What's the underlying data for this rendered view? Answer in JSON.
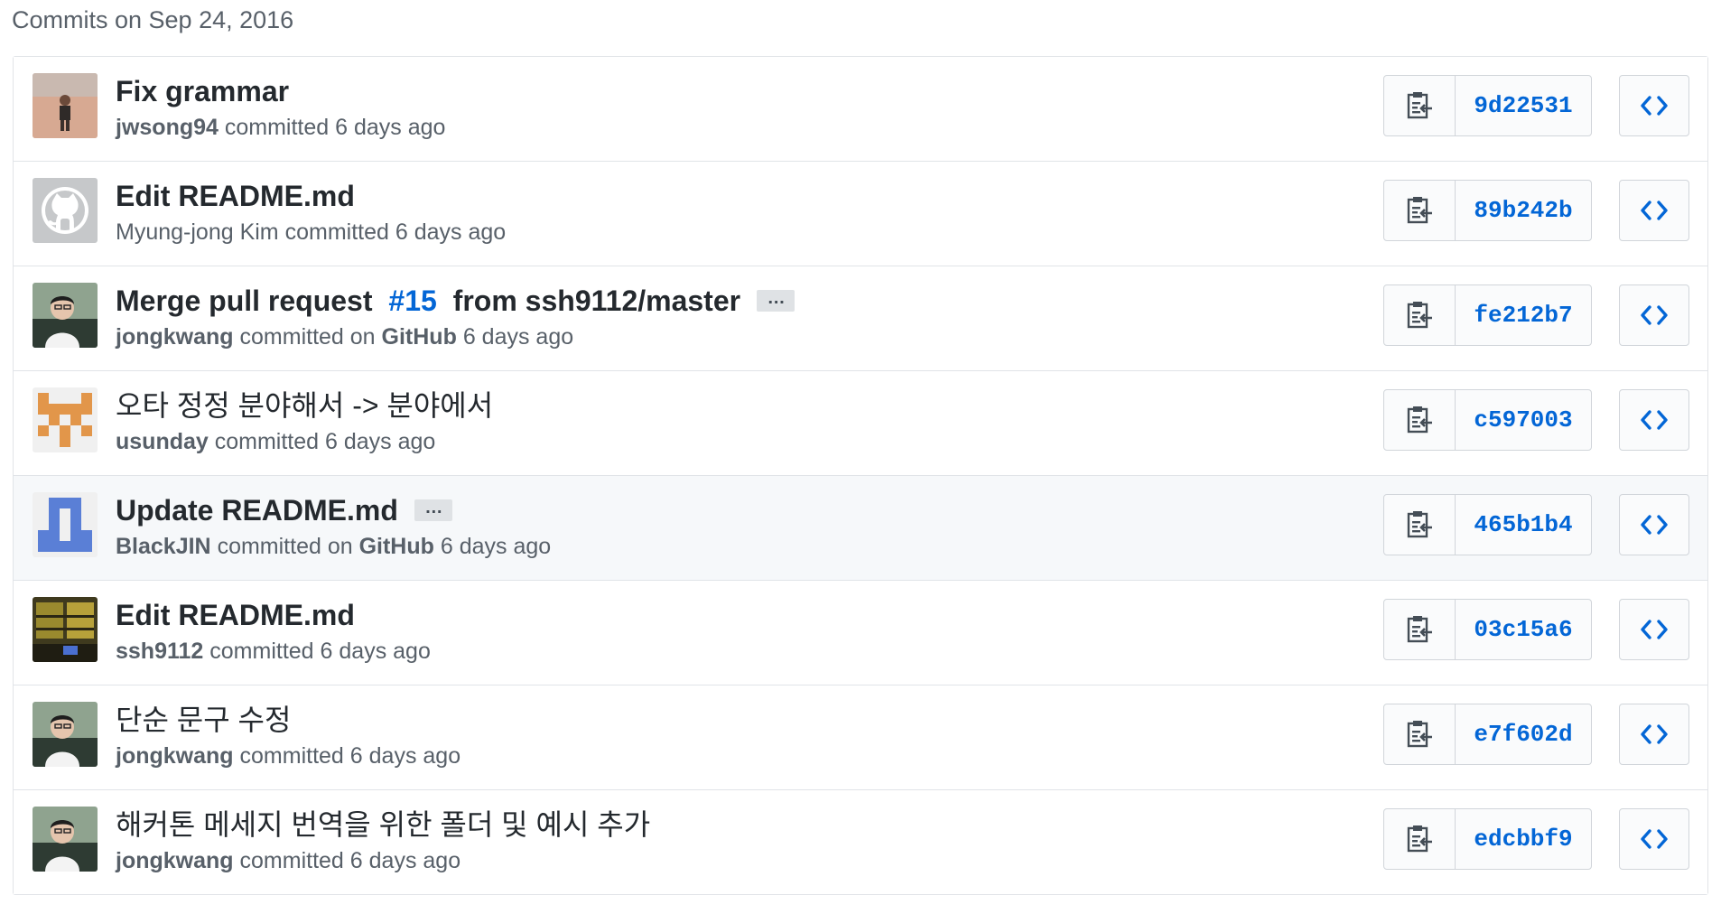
{
  "group_title": "Commits on Sep 24, 2016",
  "colors": {
    "link": "#0366d6",
    "muted": "#586069",
    "border": "#e1e4e8"
  },
  "commits": [
    {
      "title": "Fix grammar",
      "author": "jwsong94",
      "committed_text": "committed",
      "time": "6 days ago",
      "sha": "9d22531",
      "avatar_icon": "photo-avatar-field"
    },
    {
      "title": "Edit README.md",
      "author": "Myung-jong Kim",
      "committed_text": "committed",
      "time": "6 days ago",
      "sha": "89b242b",
      "avatar_icon": "github-octocat-default-avatar"
    },
    {
      "title_prefix": "Merge pull request ",
      "issue_ref": "#15",
      "title_suffix": " from ssh9112/master",
      "author": "jongkwang",
      "committed_text": "committed on",
      "platform": "GitHub",
      "time": "6 days ago",
      "sha": "fe212b7",
      "has_ellipsis": true,
      "ellipsis_label": "…",
      "avatar_icon": "photo-avatar-person"
    },
    {
      "title": "오타 정정 분야해서 -> 분야에서",
      "author": "usunday",
      "committed_text": "committed",
      "time": "6 days ago",
      "sha": "c597003",
      "avatar_icon": "identicon-orange"
    },
    {
      "title": "Update README.md",
      "author": "BlackJIN",
      "committed_text": "committed on",
      "platform": "GitHub",
      "time": "6 days ago",
      "sha": "465b1b4",
      "has_ellipsis": true,
      "ellipsis_label": "…",
      "highlighted": true,
      "avatar_icon": "identicon-blue"
    },
    {
      "title": "Edit README.md",
      "author": "ssh9112",
      "committed_text": "committed",
      "time": "6 days ago",
      "sha": "03c15a6",
      "avatar_icon": "photo-avatar-room"
    },
    {
      "title": "단순 문구 수정",
      "author": "jongkwang",
      "committed_text": "committed",
      "time": "6 days ago",
      "sha": "e7f602d",
      "avatar_icon": "photo-avatar-person"
    },
    {
      "title": "해커톤 메세지 번역을 위한 폴더 및 예시 추가",
      "author": "jongkwang",
      "committed_text": "committed",
      "time": "6 days ago",
      "sha": "edcbbf9",
      "avatar_icon": "photo-avatar-person"
    }
  ],
  "icons": {
    "copy": "clipboard-copy-icon",
    "browse": "code-brackets-icon"
  }
}
